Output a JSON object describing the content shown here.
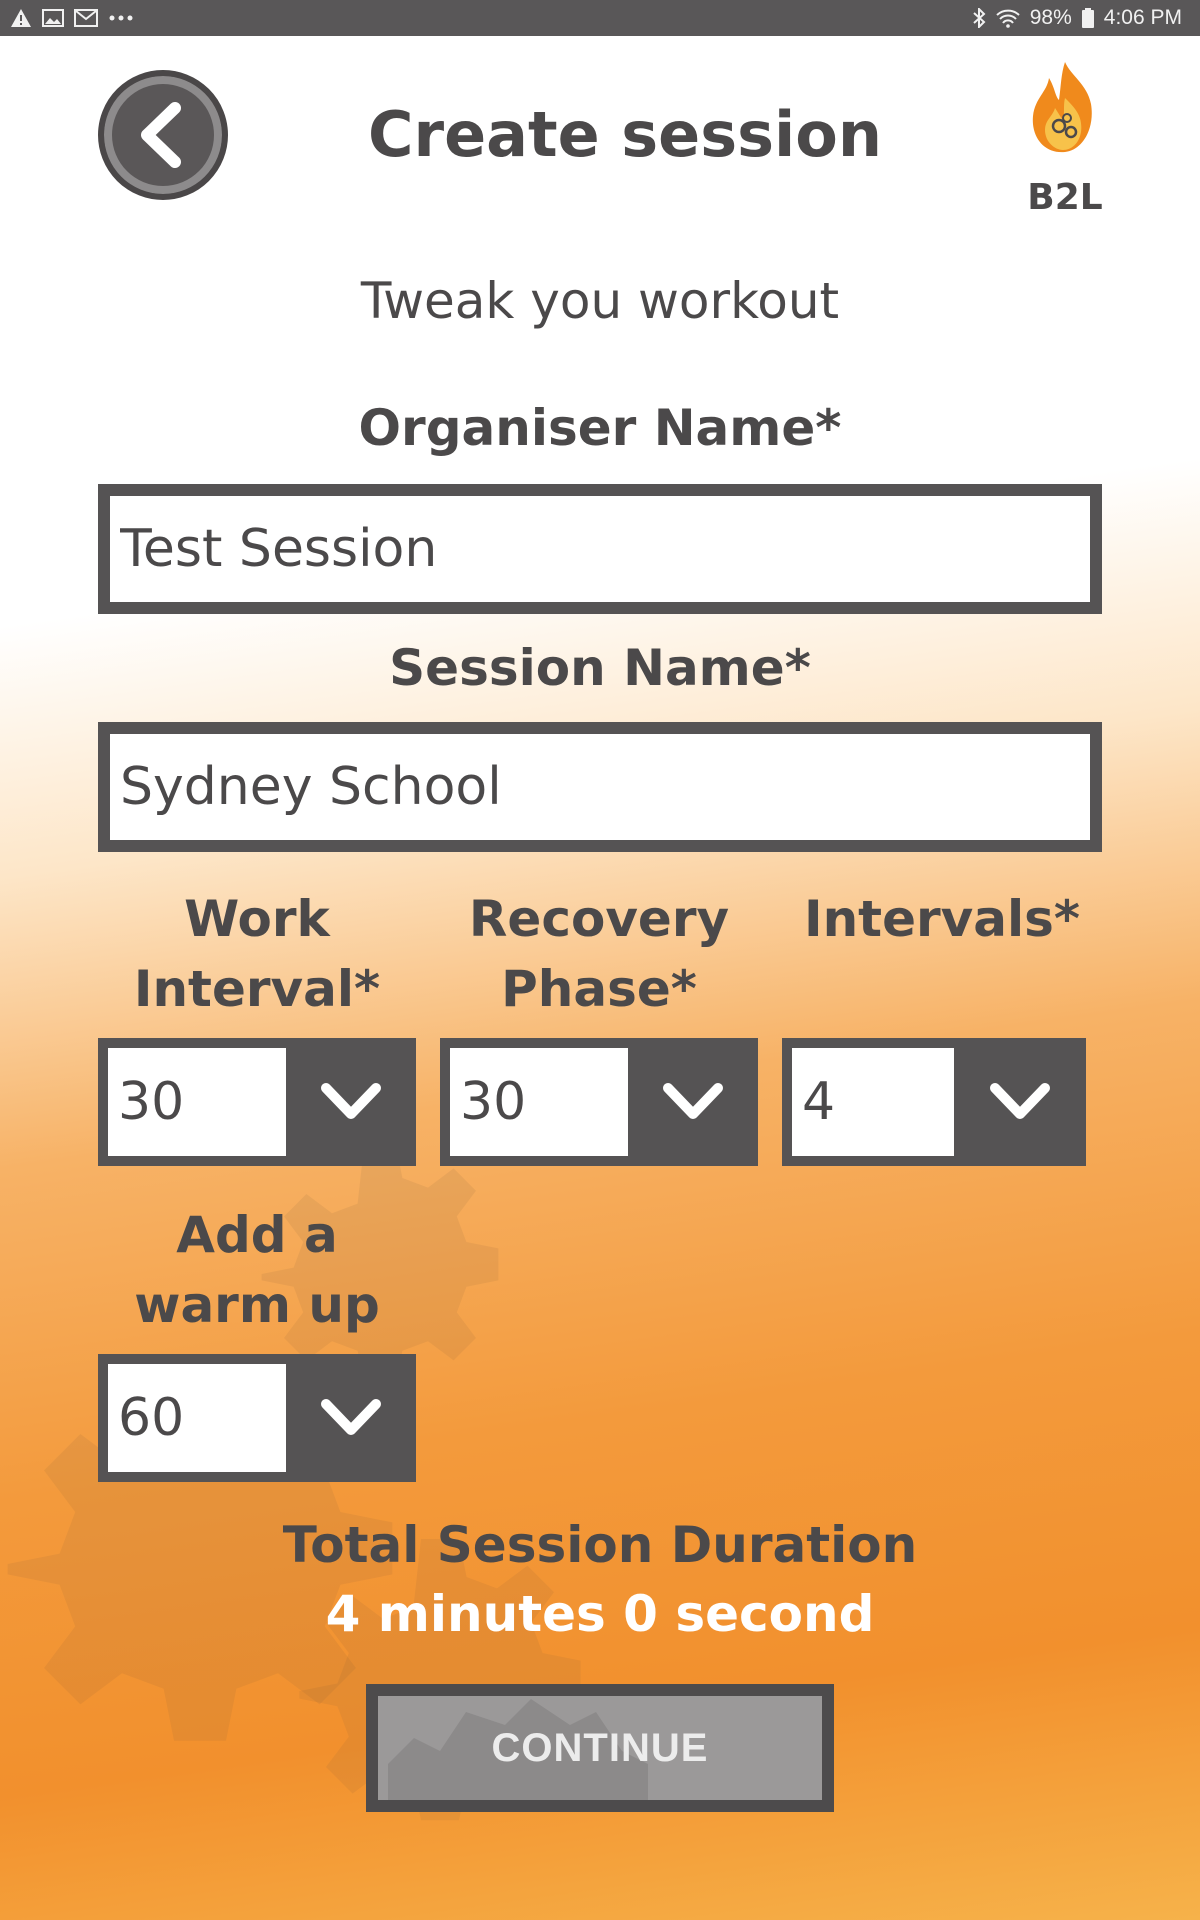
{
  "status_bar": {
    "battery": "98%",
    "time": "4:06 PM",
    "icons_left": [
      "alert-icon",
      "image-icon",
      "mail-icon",
      "more-dots-icon"
    ],
    "icons_right": [
      "bluetooth-icon",
      "wifi-icon",
      "battery-icon"
    ]
  },
  "header": {
    "title": "Create session",
    "back_icon": "chevron-left-icon",
    "logo_text": "B2L"
  },
  "subtitle": "Tweak you workout",
  "organiser": {
    "label": "Organiser Name*",
    "value": "Test Session"
  },
  "session": {
    "label": "Session Name*",
    "value": "Sydney School"
  },
  "work_interval": {
    "label_line1": "Work",
    "label_line2": "Interval*",
    "value": "30"
  },
  "recovery_phase": {
    "label_line1": "Recovery",
    "label_line2": "Phase*",
    "value": "30"
  },
  "intervals": {
    "label": "Intervals*",
    "value": "4"
  },
  "warm_up": {
    "label_line1": "Add a",
    "label_line2": "warm up",
    "value": "60"
  },
  "total": {
    "label": "Total Session Duration",
    "value": "4 minutes 0 second"
  },
  "continue_label": "CONTINUE",
  "colors": {
    "dark_gray": "#555354",
    "text_gray": "#4b494a",
    "orange": "#f2902d",
    "button_gray": "#9b9999"
  }
}
